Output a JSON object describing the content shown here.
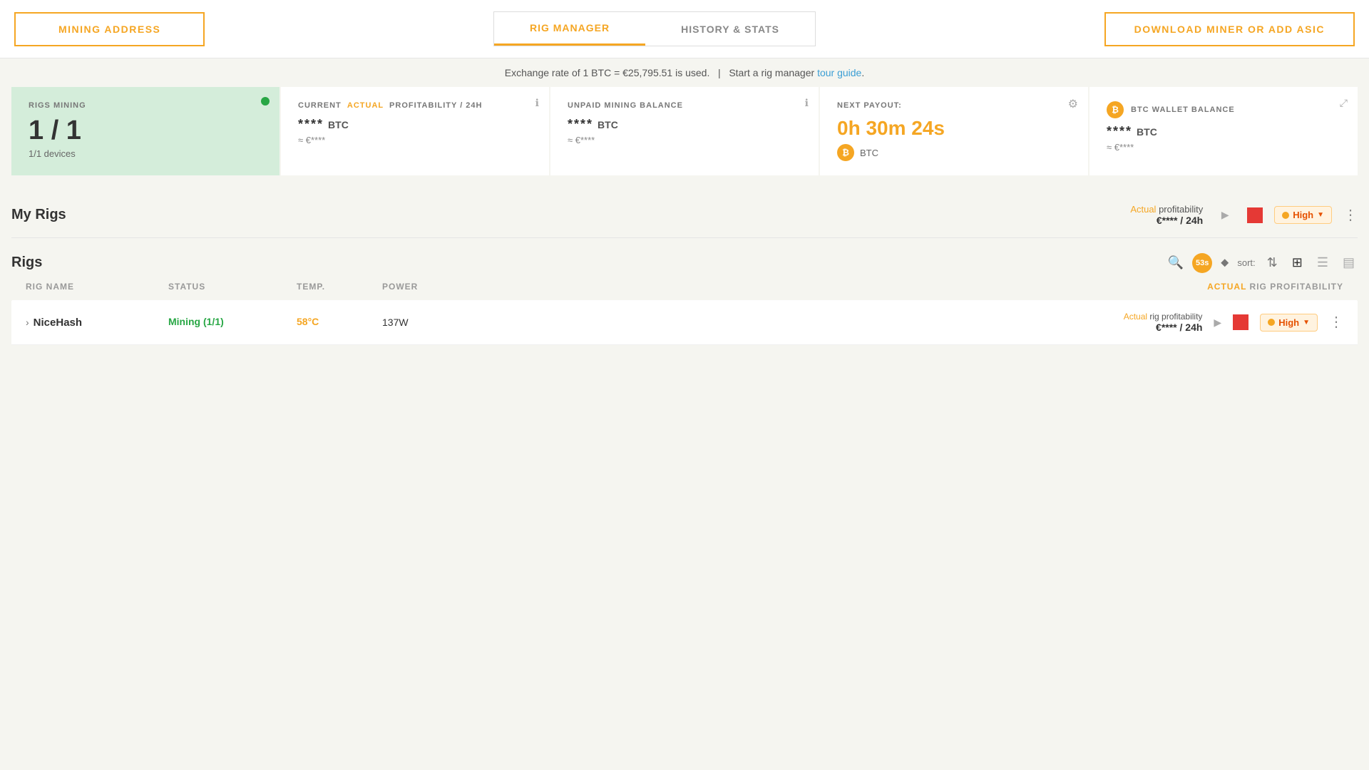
{
  "header": {
    "mining_address_label": "MINING ADDRESS",
    "download_label": "DOWNLOAD MINER OR ADD ASIC",
    "tabs": [
      {
        "id": "rig-manager",
        "label": "RIG MANAGER",
        "active": true
      },
      {
        "id": "history-stats",
        "label": "HISTORY & STATS",
        "active": false
      }
    ]
  },
  "exchange_bar": {
    "text": "Exchange rate of 1 BTC = €25,795.51 is used.",
    "separator": "|",
    "tour_text": "Start a rig manager ",
    "tour_link": "tour guide",
    "tour_punctuation": "."
  },
  "stats": {
    "rigs_mining": {
      "label": "RIGS MINING",
      "value": "1 / 1",
      "devices": "1/1 devices"
    },
    "profitability": {
      "label_current": "CURRENT",
      "label_actual": "ACTUAL",
      "label_rest": "PROFITABILITY / 24H",
      "value": "****",
      "currency": "BTC",
      "approx": "≈ €****"
    },
    "unpaid_balance": {
      "label": "UNPAID MINING BALANCE",
      "value": "****",
      "currency": "BTC",
      "approx": "≈ €****"
    },
    "next_payout": {
      "label": "NEXT PAYOUT:",
      "value": "0h 30m 24s",
      "currency": "BTC"
    },
    "btc_wallet": {
      "label": "BTC WALLET BALANCE",
      "value": "****",
      "currency": "BTC",
      "approx": "≈ €****"
    }
  },
  "my_rigs": {
    "title": "My Rigs",
    "profitability_label": "Actual profitability",
    "profitability_actual_word": "Actual",
    "profitability_rest_word": " profitability",
    "profitability_value": "€**** / 24h",
    "high_label": "High",
    "play_icon": "▶",
    "more_icon": "⋮"
  },
  "rigs": {
    "title": "Rigs",
    "sort_label": "sort:",
    "refresh_timer": "53s",
    "columns": {
      "rig_name": "Rig name",
      "status": "Status",
      "temp": "Temp.",
      "power": "Power",
      "profitability": "Actual rig profitability"
    },
    "items": [
      {
        "name": "NiceHash",
        "status": "Mining (1/1)",
        "temp": "58°C",
        "power": "137W",
        "profitability_label": "Actual rig profitability",
        "profitability_actual_word": "Actual",
        "profitability_value": "€**** / 24h",
        "high_label": "High"
      }
    ]
  },
  "icons": {
    "info": "ℹ",
    "gear": "⚙",
    "close": "✕",
    "search": "🔍",
    "filter": "▼",
    "sort_updown": "⇅",
    "grid_view": "⊞",
    "list_view": "☰",
    "compact_view": "▤",
    "more": "⋮",
    "play": "▶",
    "stop": "■",
    "chevron_right": "›",
    "btc": "₿"
  },
  "colors": {
    "orange": "#f5a623",
    "green": "#28a745",
    "red": "#e53935",
    "light_green_bg": "#d4edda",
    "blue_link": "#3b9ed4"
  }
}
